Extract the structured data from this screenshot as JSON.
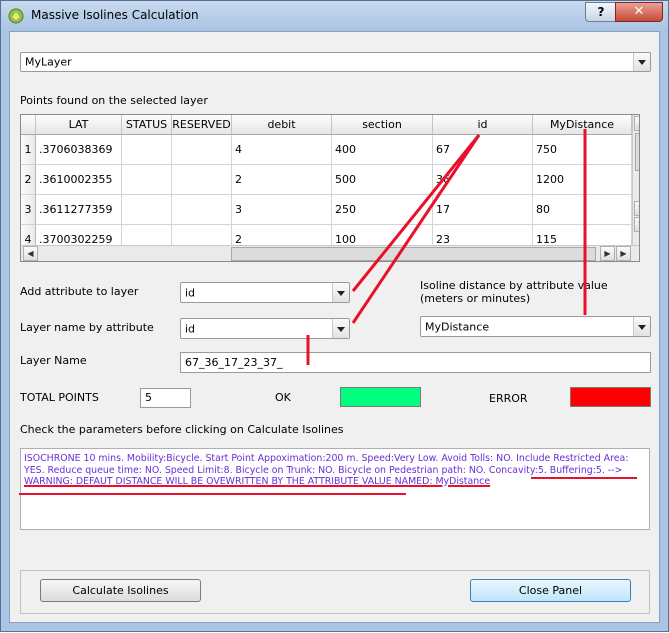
{
  "window": {
    "title": "Massive Isolines Calculation",
    "help_label": "?",
    "close_label": "✕"
  },
  "layer_select": {
    "value": "MyLayer"
  },
  "points_label": "Points found on the selected layer",
  "table": {
    "columns": [
      "LAT",
      "STATUS",
      "RESERVED",
      "debit",
      "section",
      "id",
      "MyDistance"
    ],
    "rows": [
      {
        "n": "1",
        "cells": [
          ".3706038369",
          "",
          "",
          "4",
          "400",
          "67",
          "750"
        ]
      },
      {
        "n": "2",
        "cells": [
          ".3610002355",
          "",
          "",
          "2",
          "500",
          "36",
          "1200"
        ]
      },
      {
        "n": "3",
        "cells": [
          ".3611277359",
          "",
          "",
          "3",
          "250",
          "17",
          "80"
        ]
      },
      {
        "n": "4",
        "cells": [
          ".3700302259",
          "",
          "",
          "2",
          "100",
          "23",
          "115"
        ]
      }
    ]
  },
  "form": {
    "add_attribute_label": "Add attribute to layer",
    "add_attribute_value": "id",
    "layer_name_by_attr_label": "Layer name by attribute",
    "layer_name_by_attr_value": "id",
    "isoline_label": "Isoline distance by attribute value (meters or minutes)",
    "isoline_value": "MyDistance",
    "layer_name_label": "Layer Name",
    "layer_name_value": "67_36_17_23_37_",
    "total_points_label": "TOTAL POINTS",
    "total_points_value": "5",
    "ok_label": "OK",
    "error_label": "ERROR",
    "ok_color": "#00ff80",
    "error_color": "#ff0000"
  },
  "check_label": "Check the parameters before clicking on Calculate Isolines",
  "info_text": {
    "main": "ISOCHRONE 10 mins. Mobility:Bicycle. Start Point Appoximation:200 m. Speed:Very Low. Avoid Tolls: NO. Include Restricted Area: YES. Reduce queue time: NO. Speed Limit:8. Bicycle on Trunk: NO. Bicycle on Pedestrian path: NO. Concavity:5. Buffering:5. -->",
    "warning": "WARNING: DEFAUT DISTANCE WILL BE OVEWRITTEN BY THE ATTRIBUTE VALUE NAMED: MyDistance"
  },
  "buttons": {
    "calculate": "Calculate Isolines",
    "close_panel": "Close Panel"
  },
  "annotation_color": "#e8102a",
  "text_color_info": "#6a2fd8"
}
